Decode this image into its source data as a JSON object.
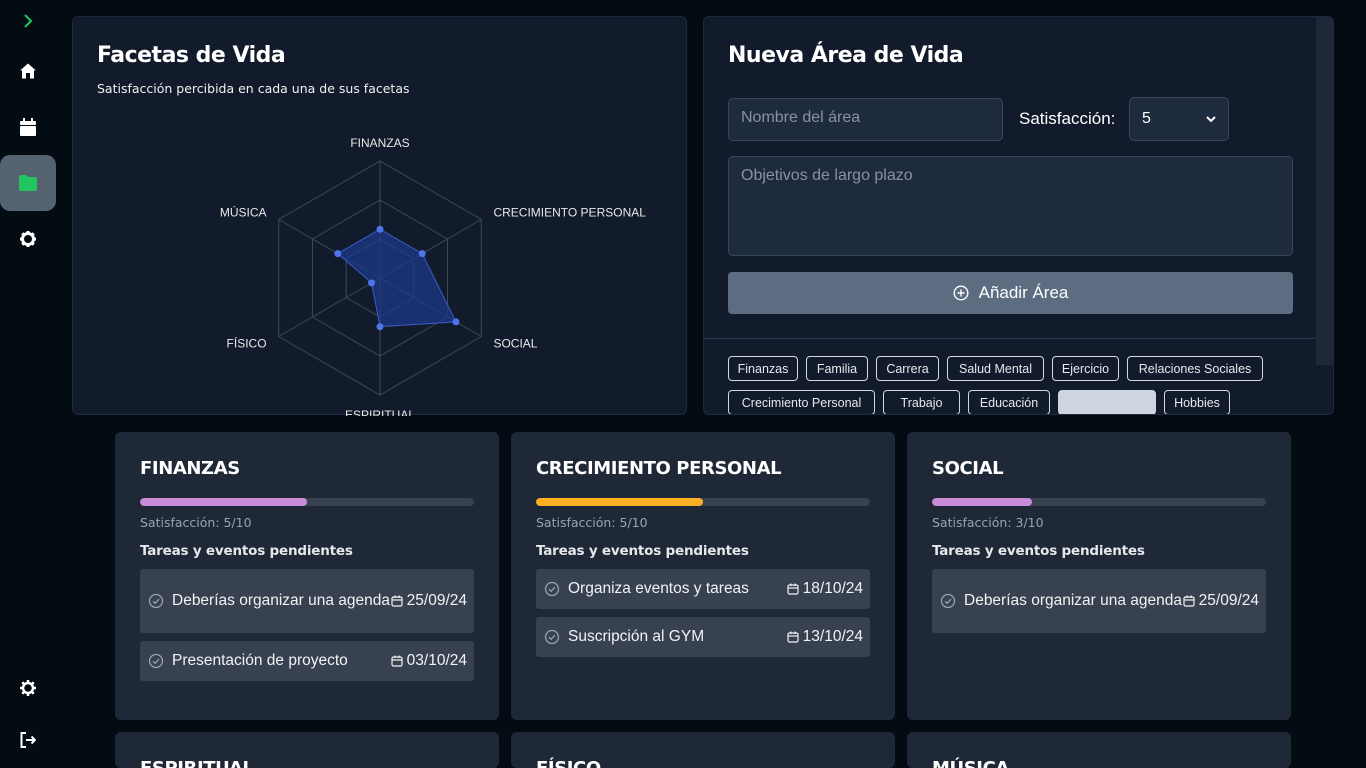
{
  "sidebar": {
    "items": [
      {
        "icon": "chevron-right-icon"
      },
      {
        "icon": "home-icon"
      },
      {
        "icon": "calendar-icon"
      },
      {
        "icon": "folder-icon",
        "active": true
      },
      {
        "icon": "gear-icon"
      },
      {
        "icon": "gear-icon"
      },
      {
        "icon": "logout-icon"
      }
    ],
    "accent": "#22c55e"
  },
  "facetas": {
    "title": "Facetas de Vida",
    "subtitle": "Satisfacción percibida en cada una de sus facetas",
    "chart_data": {
      "type": "radar",
      "axes": [
        "FINANZAS",
        "CRECIMIENTO PERSONAL",
        "SOCIAL",
        "ESPIRITUAL",
        "FÍSICO",
        "MÚSICA"
      ],
      "values": [
        5,
        5,
        9,
        5,
        1,
        5
      ],
      "max": 12,
      "rings": 3,
      "fill_color": "#1e3a8a",
      "point_color": "#4f73e8"
    }
  },
  "nueva": {
    "title": "Nueva Área de Vida",
    "name_placeholder": "Nombre del área",
    "sat_label": "Satisfacción:",
    "sat_value": "5",
    "obj_placeholder": "Objetivos de largo plazo",
    "add_label": "Añadir Área",
    "tags": [
      "Finanzas",
      "Familia",
      "Carrera",
      "Salud Mental",
      "Ejercicio",
      "Relaciones Sociales",
      "Crecimiento Personal",
      "Trabajo",
      "Educación",
      "",
      "Hobbies"
    ]
  },
  "cards": [
    {
      "title": "FINANZAS",
      "satisfaction_value": 5,
      "satisfaction_text": "Satisfacción: 5/10",
      "bar_color": "#c98bd8",
      "pending_label": "Tareas y eventos pendientes",
      "tasks": [
        {
          "text": "Deberías organizar una agenda",
          "date": "25/09/24"
        },
        {
          "text": "Presentación de proyecto",
          "date": "03/10/24"
        }
      ]
    },
    {
      "title": "CRECIMIENTO PERSONAL",
      "satisfaction_value": 5,
      "satisfaction_text": "Satisfacción: 5/10",
      "bar_color": "#fbb024",
      "pending_label": "Tareas y eventos pendientes",
      "tasks": [
        {
          "text": "Organiza eventos y tareas",
          "date": "18/10/24"
        },
        {
          "text": "Suscripción al GYM",
          "date": "13/10/24"
        }
      ]
    },
    {
      "title": "SOCIAL",
      "satisfaction_value": 3,
      "satisfaction_text": "Satisfacción: 3/10",
      "bar_color": "#c98bd8",
      "pending_label": "Tareas y eventos pendientes",
      "tasks": [
        {
          "text": "Deberías organizar una agenda",
          "date": "25/09/24"
        }
      ]
    },
    {
      "title": "ESPIRITUAL"
    },
    {
      "title": "FÍSICO"
    },
    {
      "title": "MÚSICA"
    }
  ]
}
